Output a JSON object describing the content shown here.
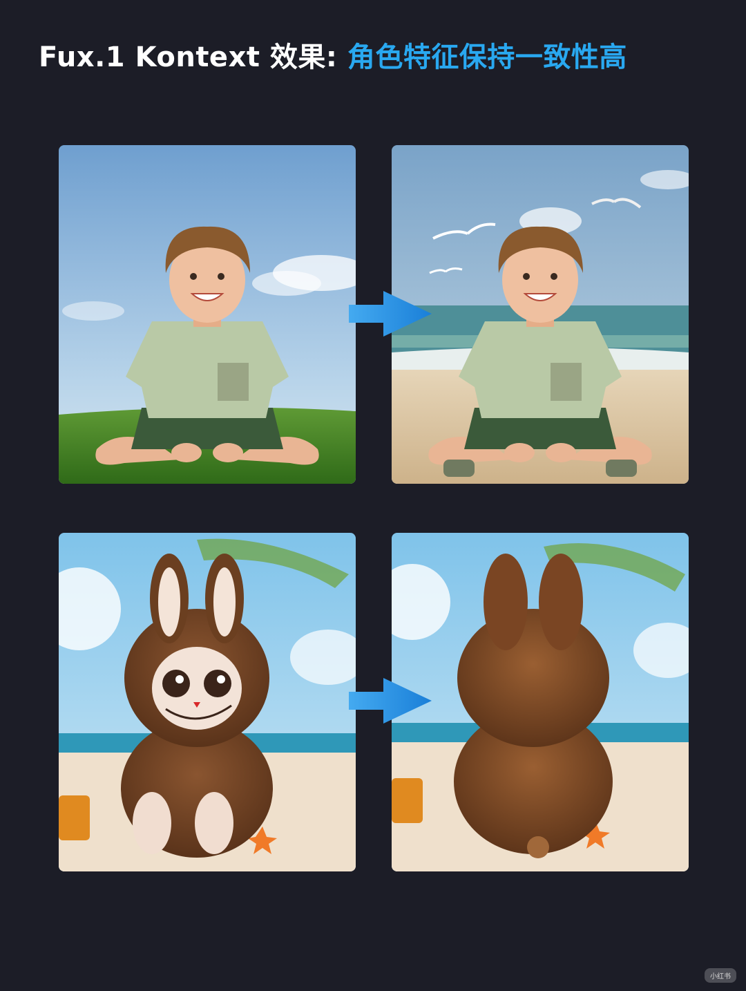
{
  "header": {
    "title_prefix": "Fux.1 Kontext 效果:",
    "title_highlight": "角色特征保持一致性高"
  },
  "colors": {
    "background": "#1c1d27",
    "title_text": "#ffffff",
    "title_accent": "#29a8f0",
    "arrow": "#2e9be6"
  },
  "panels": [
    {
      "row": 1,
      "role": "input",
      "subject": "boy sitting on grass"
    },
    {
      "row": 1,
      "role": "output",
      "subject": "boy sitting on beach"
    },
    {
      "row": 2,
      "role": "input",
      "subject": "brown plush bunny figure front view on beach"
    },
    {
      "row": 2,
      "role": "output",
      "subject": "brown plush bunny figure back view on beach"
    }
  ],
  "icons": [
    "right-arrow-icon",
    "right-arrow-icon"
  ],
  "watermark": "小红书"
}
